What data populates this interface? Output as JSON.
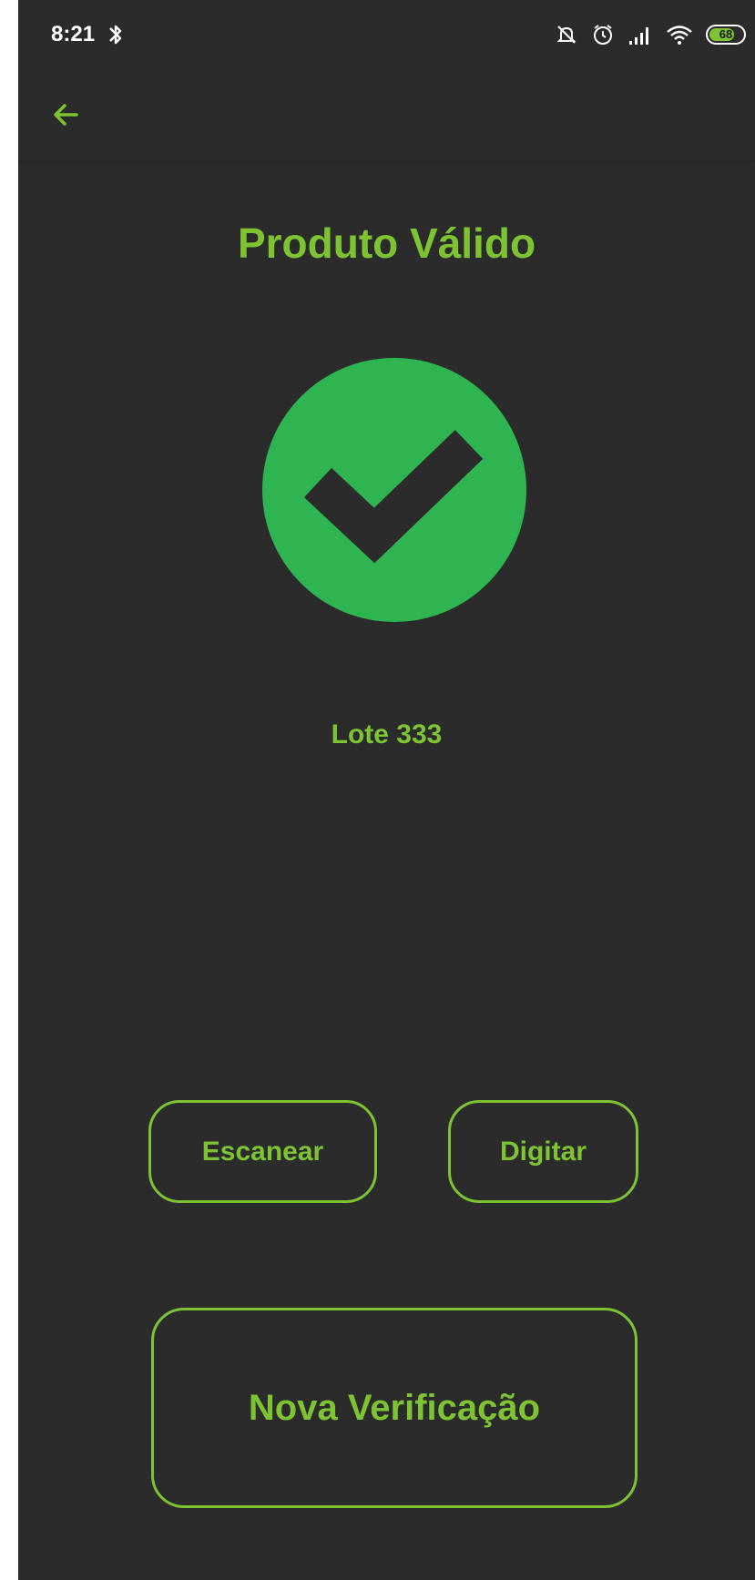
{
  "status_bar": {
    "time": "8:21",
    "battery_level": "68",
    "icons": [
      "bluetooth-icon",
      "notifications-off-icon",
      "alarm-icon",
      "signal-icon",
      "wifi-icon",
      "battery-icon"
    ]
  },
  "app_bar": {
    "back_icon": "arrow-left-icon"
  },
  "main": {
    "title": "Produto Válido",
    "status_icon": "check-circle-icon",
    "lot_label": "Lote 333"
  },
  "actions": {
    "scan_label": "Escanear",
    "type_label": "Digitar",
    "new_check_label": "Nova Verificação"
  },
  "colors": {
    "background": "#2b2b2b",
    "accent": "#7dc332",
    "success_circle": "#2fb452"
  }
}
